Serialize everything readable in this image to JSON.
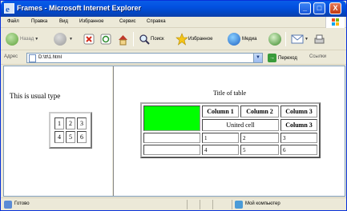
{
  "window": {
    "title": "Frames - Microsoft Internet Explorer",
    "minimize": "_",
    "maximize": "□",
    "close": "X"
  },
  "menu": [
    "Файл",
    "Правка",
    "Вид",
    "Избранное",
    "Сервис",
    "Справка"
  ],
  "toolbar": {
    "back_label": "Назад",
    "search_label": "Поиск",
    "favorites_label": "Избранное",
    "media_label": "Медиа"
  },
  "address": {
    "label": "Адрес",
    "url": "D:\\tt\\1.html",
    "go_label": "Переход",
    "links_label": "Ссылки"
  },
  "left_frame": {
    "text": "This is usual type",
    "small_table": [
      [
        "1",
        "2",
        "3"
      ],
      [
        "4",
        "5",
        "6"
      ]
    ]
  },
  "right_frame": {
    "table_title": "Title of table",
    "headers": [
      "Column 1",
      "Column 2",
      "Column 3"
    ],
    "united_cell": "United cell",
    "row2_col3": "Column 3",
    "rows": [
      [
        "",
        "1",
        "2",
        "3"
      ],
      [
        "",
        "4",
        "5",
        "6"
      ]
    ],
    "green_cell_color": "#00ff00"
  },
  "status": {
    "text": "Готово",
    "zone": "Мой компьютер"
  }
}
